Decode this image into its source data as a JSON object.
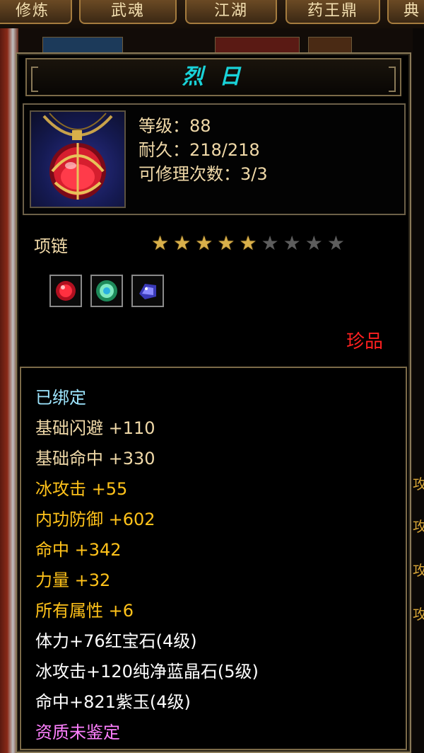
{
  "tabs": [
    "修炼",
    "武魂",
    "江湖",
    "药王鼎",
    "典"
  ],
  "item": {
    "name": "烈 日",
    "level": "等级：88",
    "durability": "耐久：218/218",
    "repairs": "可修理次数：3/3",
    "type": "项链",
    "stars": {
      "filled": 5,
      "total": 9
    },
    "gems": [
      "red-gem-icon",
      "green-gem-icon",
      "blue-gem-icon"
    ],
    "rarity": "珍品"
  },
  "attributes": [
    {
      "text": "已绑定",
      "color": "#9ee6ff"
    },
    {
      "text": "基础闪避 +110",
      "color": "#f0d9a8"
    },
    {
      "text": "基础命中 +330",
      "color": "#f0d9a8"
    },
    {
      "text": "冰攻击 +55",
      "color": "#ffc21a"
    },
    {
      "text": "内功防御 +602",
      "color": "#ffc21a"
    },
    {
      "text": "命中 +342",
      "color": "#ffc21a"
    },
    {
      "text": "力量 +32",
      "color": "#ffc21a"
    },
    {
      "text": "所有属性 +6",
      "color": "#ffc21a"
    },
    {
      "text": "体力+76红宝石(4级)",
      "color": "#ffffff"
    },
    {
      "text": "冰攻击+120纯净蓝晶石(5级)",
      "color": "#ffffff"
    },
    {
      "text": "命中+821紫玉(4级)",
      "color": "#ffffff"
    },
    {
      "text": "资质未鉴定",
      "color": "#ff80ff"
    }
  ],
  "colors": {
    "title": "#19d2d8",
    "rarity": "#ff2020",
    "panel_border": "#8a7a58"
  }
}
